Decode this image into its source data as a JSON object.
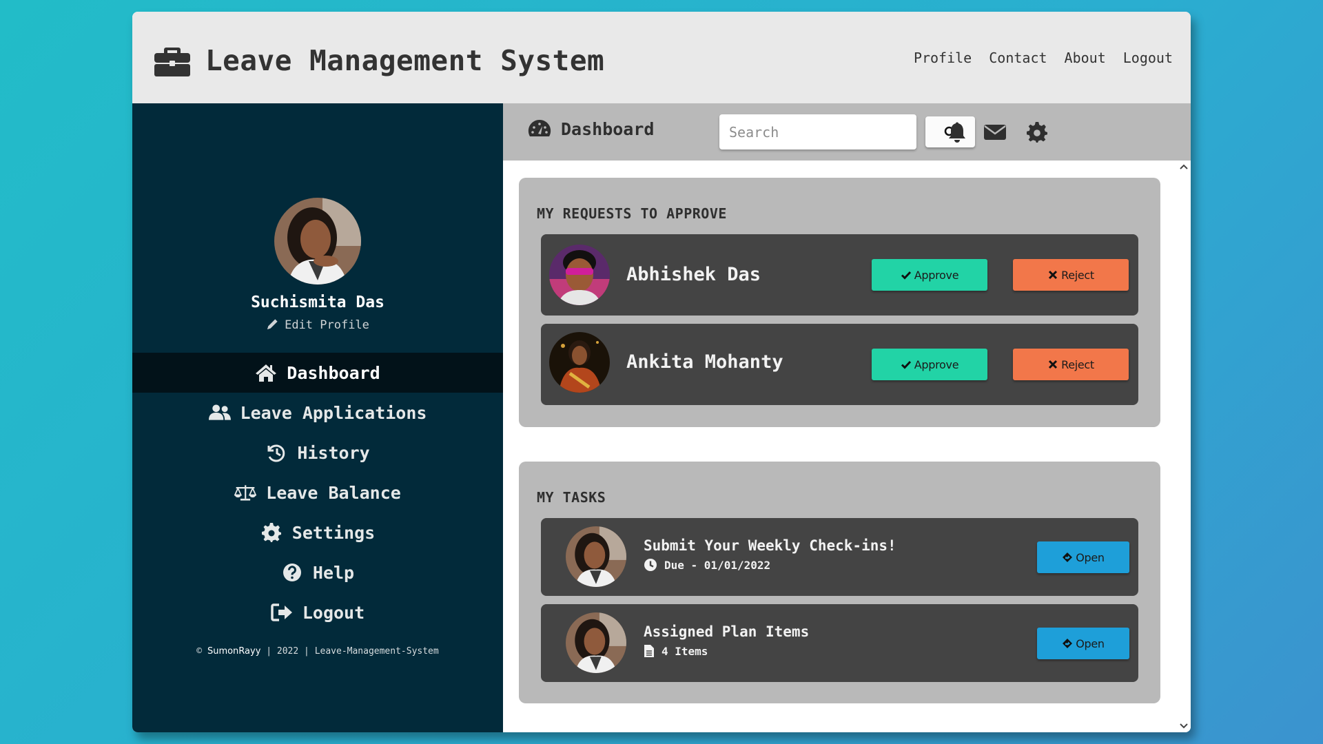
{
  "header": {
    "title": "Leave Management System",
    "nav": [
      "Profile",
      "Contact",
      "About",
      "Logout"
    ]
  },
  "sidebar": {
    "user_name": "Suchismita Das",
    "edit_profile": "Edit Profile",
    "menu": [
      {
        "label": "Dashboard",
        "icon": "home-icon",
        "active": true
      },
      {
        "label": "Leave Applications",
        "icon": "users-icon"
      },
      {
        "label": "History",
        "icon": "history-icon"
      },
      {
        "label": "Leave Balance",
        "icon": "balance-scale-icon"
      },
      {
        "label": "Settings",
        "icon": "gear-icon"
      },
      {
        "label": "Help",
        "icon": "help-icon"
      },
      {
        "label": "Logout",
        "icon": "logout-icon"
      }
    ],
    "footer": {
      "symbol": "©",
      "brand": "SumonRayy",
      "sep1": "|",
      "year": "2022",
      "sep2": "|",
      "project": "Leave-Management-System"
    }
  },
  "topbar": {
    "title": "Dashboard",
    "search_placeholder": "Search"
  },
  "requests": {
    "title": "MY REQUESTS TO APPROVE",
    "items": [
      {
        "name": "Abhishek Das",
        "approve": "Approve",
        "reject": "Reject"
      },
      {
        "name": "Ankita Mohanty",
        "approve": "Approve",
        "reject": "Reject"
      }
    ]
  },
  "tasks": {
    "title": "MY TASKS",
    "items": [
      {
        "title": "Submit Your Weekly Check-ins!",
        "sub": "Due - 01/01/2022",
        "sub_icon": "clock-icon",
        "action": "Open"
      },
      {
        "title": "Assigned Plan Items",
        "sub": "4 Items",
        "sub_icon": "file-icon",
        "action": "Open"
      }
    ]
  },
  "colors": {
    "header_bg": "#e9e9e9",
    "sidebar_bg": "#022a3a",
    "sidebar_active": "#021219",
    "card_bg": "#b9b9b9",
    "row_bg": "#444444",
    "approve": "#22d3a6",
    "reject": "#f2774a",
    "open": "#1e9fd9"
  }
}
